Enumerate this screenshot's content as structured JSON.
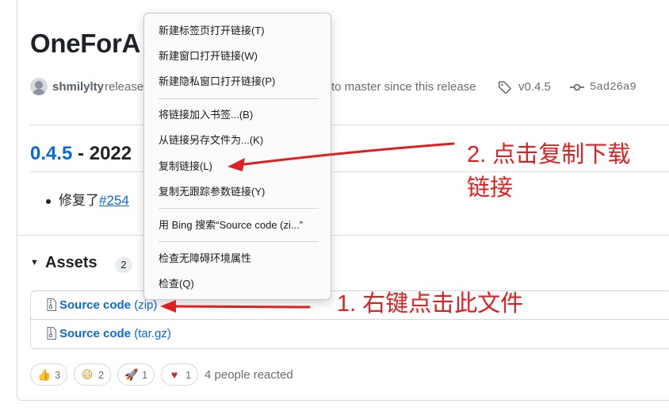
{
  "release": {
    "title": "OneForA",
    "author": "shmilylty",
    "released_text": "released",
    "commits_text": "to master since this release",
    "tag": "v0.4.5",
    "commit": "5ad26a9",
    "version_link": "0.4.5",
    "version_rest": " - 2022",
    "note_prefix": "修复了",
    "note_link": "#254"
  },
  "assets": {
    "title": "Assets",
    "count": "2",
    "items": [
      {
        "name": "Source code",
        "ext": "(zip)"
      },
      {
        "name": "Source code",
        "ext": "(tar.gz)"
      }
    ]
  },
  "reactions": {
    "items": [
      {
        "emoji": "thumbs-up",
        "glyph": "👍",
        "count": "3"
      },
      {
        "emoji": "smile",
        "glyph": "😄",
        "count": "2"
      },
      {
        "emoji": "rocket",
        "glyph": "🚀",
        "count": "1"
      },
      {
        "emoji": "heart",
        "glyph": "♥",
        "count": "1"
      }
    ],
    "summary": "4 people reacted"
  },
  "context_menu": {
    "items": [
      "新建标签页打开链接(T)",
      "新建窗口打开链接(W)",
      "新建隐私窗口打开链接(P)",
      "将链接加入书签...(B)",
      "从链接另存文件为...(K)",
      "复制链接(L)",
      "复制无跟踪参数链接(Y)",
      "用 Bing 搜索“Source code (zi...”",
      "检查无障碍环境属性",
      "检查(Q)"
    ]
  },
  "annotations": {
    "step1": "1. 右键点击此文件",
    "step2_line1": "2. 点击复制下载",
    "step2_line2": "链接",
    "color": "#e02020"
  },
  "colors": {
    "link": "#0969da",
    "text": "#1f2328",
    "muted": "#656d76",
    "border": "#d0d7de"
  }
}
